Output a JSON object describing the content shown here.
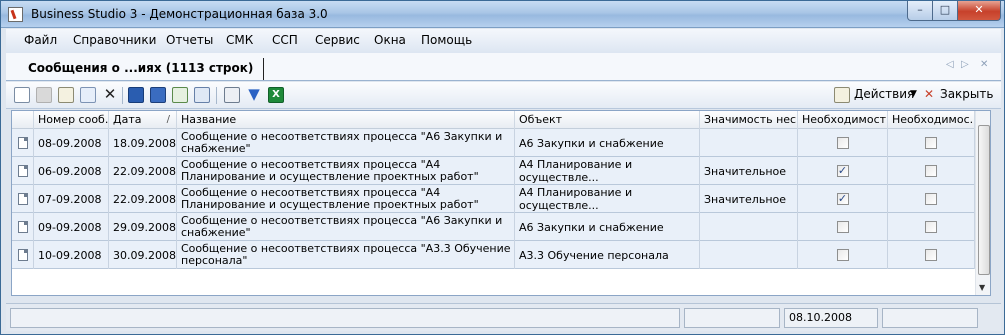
{
  "window": {
    "title": "Business Studio 3 - Демонстрационная база 3.0"
  },
  "menu": [
    "Файл",
    "Справочники",
    "Отчеты",
    "СМК",
    "ССП",
    "Сервис",
    "Окна",
    "Помощь"
  ],
  "tab": {
    "label": "Сообщения о ...иях (1113 строк)"
  },
  "toolbar": {
    "actions_label": "Действия",
    "close_label": "Закрыть"
  },
  "grid": {
    "columns": [
      "Номер сооб...",
      "Дата",
      "Название",
      "Объект",
      "Значимость нес...",
      "Необходимост...",
      "Необходимос..."
    ],
    "sort_mark": "/",
    "rows": [
      {
        "number": "08-09.2008",
        "date": "18.09.2008",
        "name": "Сообщение о несоответствиях процесса \"А6 Закупки и снабжение\"",
        "object": "А6 Закупки и снабжение",
        "significance": "",
        "need1": false,
        "need2": false
      },
      {
        "number": "06-09.2008",
        "date": "22.09.2008",
        "name": "Сообщение о несоответствиях процесса \"А4 Планирование и осуществление проектных работ\"",
        "object": "А4 Планирование и осуществле...",
        "significance": "Значительное",
        "need1": true,
        "need2": false
      },
      {
        "number": "07-09.2008",
        "date": "22.09.2008",
        "name": "Сообщение о несоответствиях процесса \"А4 Планирование и осуществление проектных работ\"",
        "object": "А4 Планирование и осуществле...",
        "significance": "Значительное",
        "need1": true,
        "need2": false
      },
      {
        "number": "09-09.2008",
        "date": "29.09.2008",
        "name": "Сообщение о несоответствиях процесса \"А6 Закупки и снабжение\"",
        "object": "А6 Закупки и снабжение",
        "significance": "",
        "need1": false,
        "need2": false
      },
      {
        "number": "10-09.2008",
        "date": "30.09.2008",
        "name": "Сообщение о несоответствиях процесса \"А3.3 Обучение персонала\"",
        "object": "А3.3 Обучение персонала",
        "significance": "",
        "need1": false,
        "need2": false
      }
    ]
  },
  "status": {
    "date": "08.10.2008"
  },
  "colors": {
    "accent": "#3b6a96",
    "row_bg": "#e9f0f9",
    "close_red": "#c7412b"
  }
}
